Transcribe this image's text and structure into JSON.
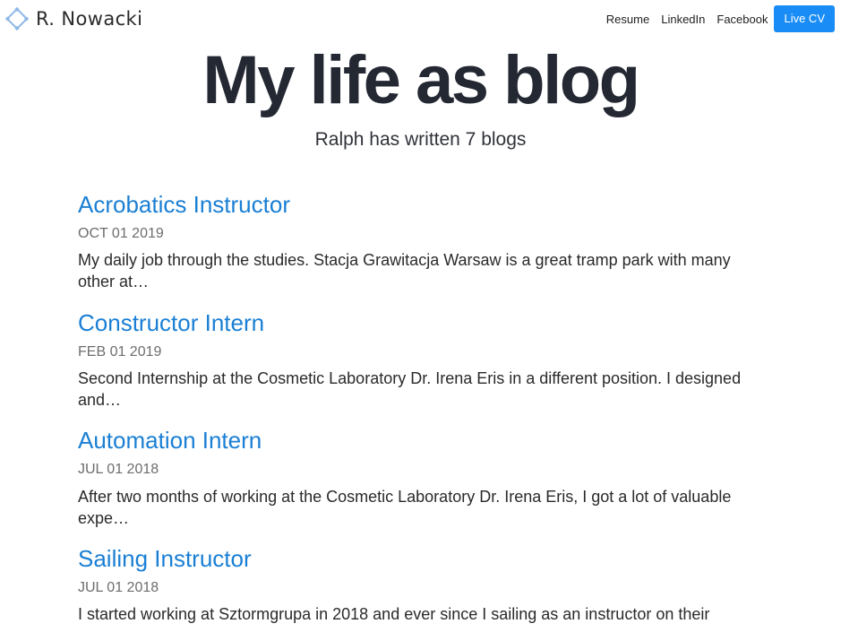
{
  "brand": {
    "name": "R. Nowacki",
    "icon": "diamond-logo-icon",
    "accent": "#1a8cf5"
  },
  "nav": {
    "links": [
      {
        "label": "Resume"
      },
      {
        "label": "LinkedIn"
      },
      {
        "label": "Facebook"
      }
    ],
    "cta": {
      "label": "Live CV"
    }
  },
  "hero": {
    "title": "My life as blog",
    "subtitle": "Ralph has written 7 blogs"
  },
  "posts": [
    {
      "title": "Acrobatics Instructor",
      "date": "OCT 01 2019",
      "excerpt": "My daily job through the studies. Stacja Grawitacja Warsaw is a great tramp park with many other at…"
    },
    {
      "title": "Constructor Intern",
      "date": "FEB 01 2019",
      "excerpt": "Second Internship at the Cosmetic Laboratory Dr. Irena Eris in a different position. I designed and…"
    },
    {
      "title": "Automation Intern",
      "date": "JUL 01 2018",
      "excerpt": "After two months of working at the Cosmetic Laboratory Dr. Irena Eris, I got a lot of valuable expe…"
    },
    {
      "title": "Sailing Instructor",
      "date": "JUL 01 2018",
      "excerpt": "I started working at Sztormgrupa in 2018 and ever since I sailing as an instructor on their"
    }
  ],
  "colors": {
    "link": "#1a7fd4",
    "title": "#232832",
    "date": "#6d6d6d"
  }
}
